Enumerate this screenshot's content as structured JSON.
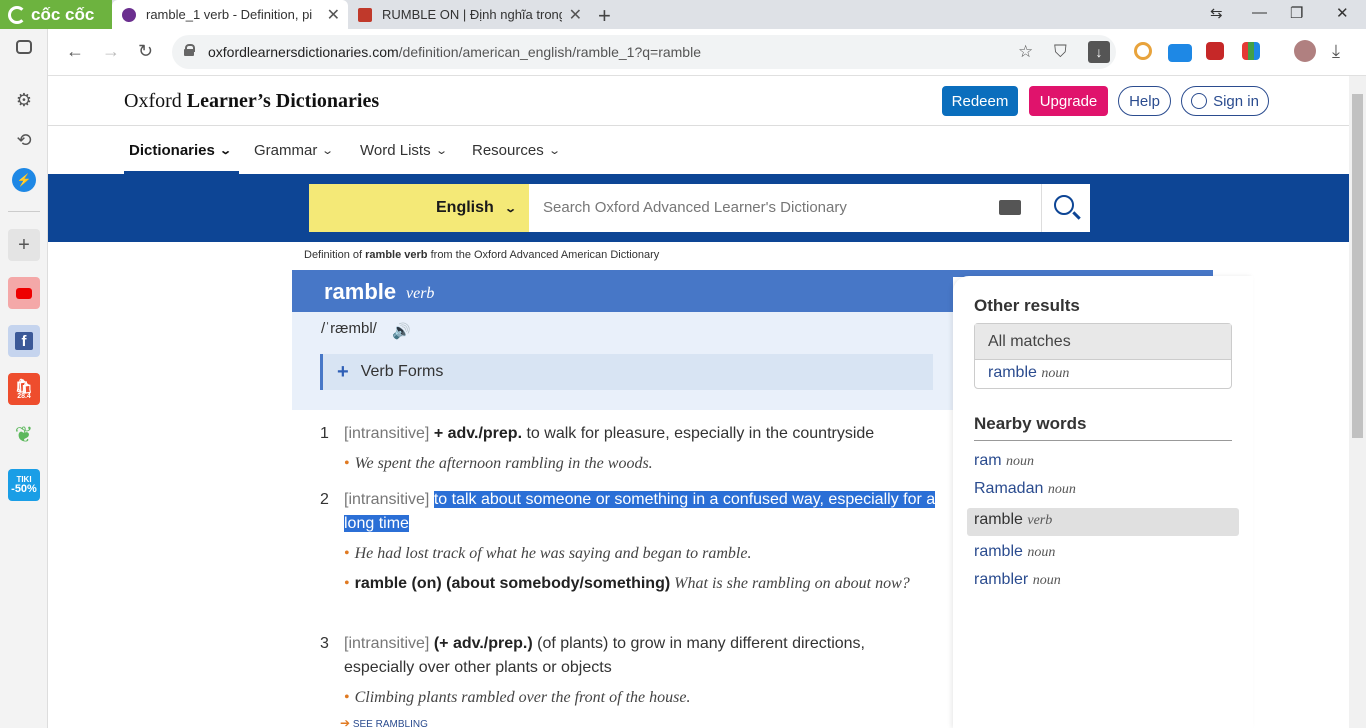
{
  "browser": {
    "brand": "cốc cốc",
    "tabs": [
      {
        "title": "ramble_1 verb - Definition, pi"
      },
      {
        "title": "RUMBLE ON | Định nghĩa trong"
      }
    ],
    "url_host": "oxfordlearnersdictionaries.com",
    "url_path": "/definition/american_english/ramble_1?q=ramble"
  },
  "header": {
    "logo_oxford": "Oxford",
    "logo_rest": "Learner’s Dictionaries",
    "redeem": "Redeem",
    "upgrade": "Upgrade",
    "help": "Help",
    "signin": "Sign in"
  },
  "subnav": {
    "dictionaries": "Dictionaries",
    "grammar": "Grammar",
    "word_lists": "Word Lists",
    "resources": "Resources"
  },
  "search": {
    "language": "English",
    "placeholder": "Search Oxford Advanced Learner's Dictionary"
  },
  "entry": {
    "source_prefix": "Definition of",
    "source_word": "ramble verb",
    "source_suffix": "from the Oxford Advanced American Dictionary",
    "headword": "ramble",
    "pos": "verb",
    "pron": "/ˈræmbl/",
    "verb_forms": "Verb Forms",
    "senses": [
      {
        "num": "1",
        "gram": "[intransitive]",
        "bold": "+ adv./prep.",
        "def": "to walk for pleasure, especially in the countryside"
      },
      {
        "num": "2",
        "gram": "[intransitive]",
        "def_hl": "to talk about someone or something in a confused way, especially for a long time"
      },
      {
        "num": "3",
        "gram": "[intransitive]",
        "bold": "(+ adv./prep.)",
        "def": "(of plants) to grow in many different directions, especially over other plants or objects"
      }
    ],
    "examples": {
      "e1": "We spent the afternoon rambling in the woods.",
      "e2": "He had lost track of what he was saying and began to ramble.",
      "e3_phrase": "ramble (on) (about somebody/something)",
      "e3": "What is she rambling on about now?",
      "e4": "Climbing plants rambled over the front of the house."
    },
    "see_also": "SEE RAMBLING"
  },
  "right_panel": {
    "other_results": "Other results",
    "all_matches": "All matches",
    "match_word": "ramble",
    "match_pos": "noun",
    "nearby_title": "Nearby words",
    "nearby": [
      {
        "word": "ram",
        "pos": "noun"
      },
      {
        "word": "Ramadan",
        "pos": "noun"
      },
      {
        "word": "ramble",
        "pos": "verb"
      },
      {
        "word": "ramble",
        "pos": "noun"
      },
      {
        "word": "rambler",
        "pos": "noun"
      }
    ]
  },
  "sidebar_badges": {
    "shopee_date": "28.4",
    "tiki_label": "TIKI",
    "tiki_discount": "-50%"
  },
  "colors": {
    "oxford_blue": "#0d4595",
    "entry_blue": "#4777c7",
    "redeem": "#0a6ebd",
    "upgrade": "#e0136c",
    "highlight": "#2b6fd6"
  }
}
